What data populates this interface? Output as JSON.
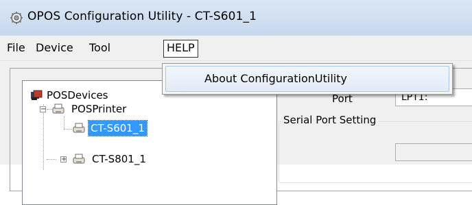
{
  "window": {
    "title": "OPOS Configuration Utility -  CT-S601_1",
    "icon": "gear-app-icon"
  },
  "menubar": {
    "items": [
      "File",
      "Device",
      "Tool",
      "HELP"
    ],
    "active_index": 3
  },
  "help_menu": {
    "items": [
      "About ConfigurationUtility"
    ]
  },
  "tree": {
    "root": "POSDevices",
    "category": "POSPrinter",
    "selected": "CT-S601_1",
    "sibling": "CT-S801_1"
  },
  "port": {
    "label": "Port",
    "value": "LPT1:"
  },
  "serial_group": {
    "title": "Serial Port Setting"
  },
  "colors": {
    "selection": "#3399ff",
    "menu_hover_border": "#a8c8ec",
    "titlebar": "#c6d8ee"
  }
}
